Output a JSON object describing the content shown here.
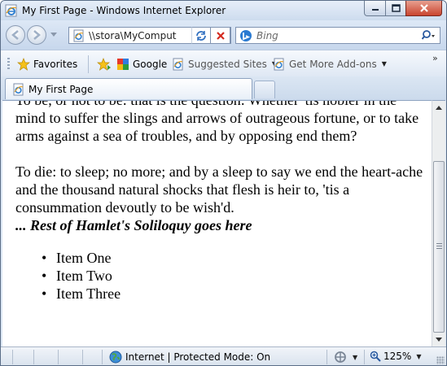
{
  "window": {
    "title": "My First Page - Windows Internet Explorer"
  },
  "address_bar": {
    "url": "\\\\stora\\MyComput"
  },
  "search": {
    "placeholder": "Bing"
  },
  "favorites_bar": {
    "favorites_label": "Favorites",
    "items": [
      {
        "label": "Google",
        "icon": "google-icon"
      },
      {
        "label": "Suggested Sites",
        "icon": "ie-page-icon"
      },
      {
        "label": "Get More Add-ons",
        "icon": "ie-page-icon"
      }
    ],
    "overflow": "»"
  },
  "tabs": [
    {
      "label": "My First Page"
    }
  ],
  "content": {
    "paragraph1": "To be, or not to be: that is the question: Whether 'tis nobler in the mind to suffer the slings and arrows of outrageous fortune, or to take arms against a sea of troubles, and by opposing end them?",
    "paragraph2": "To die: to sleep; no more; and by a sleep to say we end the heart-ache and the thousand natural shocks that flesh is heir to, 'tis a consummation devoutly to be wish'd.",
    "emphasis": "... Rest of Hamlet's Soliloquy goes here",
    "list": [
      "Item One",
      "Item Two",
      "Item Three"
    ]
  },
  "status_bar": {
    "zone": "Internet | Protected Mode: On",
    "zoom": "125%"
  },
  "colors": {
    "chrome": "#dce7f4",
    "accent": "#3a6ea5",
    "close_button": "#c9442f"
  }
}
